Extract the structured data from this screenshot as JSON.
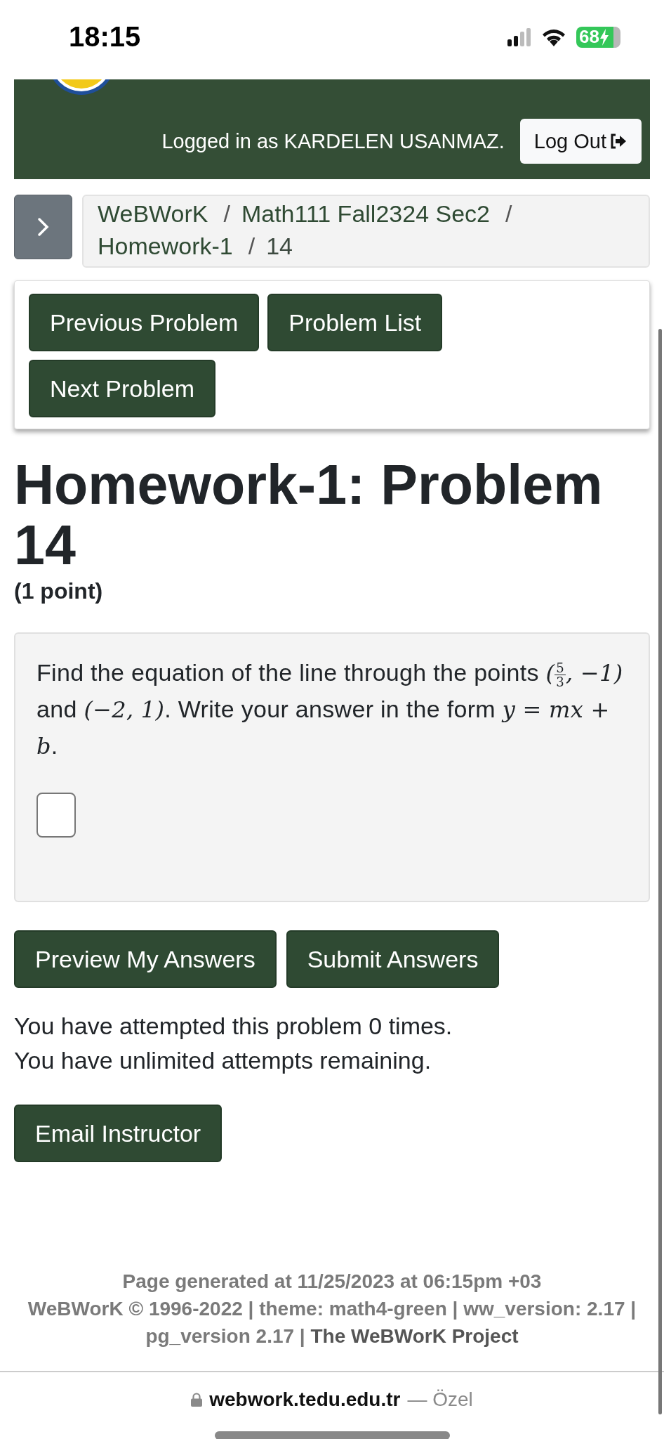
{
  "status_bar": {
    "time": "18:15",
    "battery": "68"
  },
  "header": {
    "logged_in": "Logged in as KARDELEN USANMAZ.",
    "logout": "Log Out"
  },
  "breadcrumb": [
    {
      "label": "WeBWorK",
      "current": false
    },
    {
      "separator": "/"
    },
    {
      "label": "Math111 Fall2324 Sec2",
      "current": false
    },
    {
      "separator": "/"
    },
    {
      "label": "Homework-1",
      "current": false
    },
    {
      "separator": "/"
    },
    {
      "label": "14",
      "current": true
    }
  ],
  "nav_buttons": [
    "Previous Problem",
    "Problem List",
    "Next Problem"
  ],
  "title": "Homework-1: Problem 14",
  "points": "(1 point)",
  "problem": [
    {
      "kind": "text",
      "text": "Find the equation of the line through the points "
    },
    {
      "kind": "math",
      "text": "("
    },
    {
      "kind": "frac",
      "num": "5",
      "den": "3"
    },
    {
      "kind": "math",
      "text": ", −1)"
    },
    {
      "kind": "text",
      "text": " and "
    },
    {
      "kind": "math",
      "text": "(−2, 1)"
    },
    {
      "kind": "text",
      "text": ". Write your answer in the form "
    },
    {
      "kind": "math",
      "text": "y = mx + b"
    },
    {
      "kind": "text",
      "text": "."
    }
  ],
  "answer_buttons": [
    "Preview My Answers",
    "Submit Answers"
  ],
  "attempts": [
    "You have attempted this problem 0 times.",
    "You have unlimited attempts remaining."
  ],
  "email_button": "Email Instructor",
  "footer": {
    "generated": "Page generated at 11/25/2023 at 06:15pm +03",
    "info": [
      "WeBWorK © 1996-2022 | theme: math4-green | ww_version: 2.17 |",
      "pg_version 2.17 |"
    ],
    "link": "The WeBWorK Project"
  },
  "url_bar": {
    "domain": "webwork.tedu.edu.tr",
    "suffix": "— Özel"
  }
}
